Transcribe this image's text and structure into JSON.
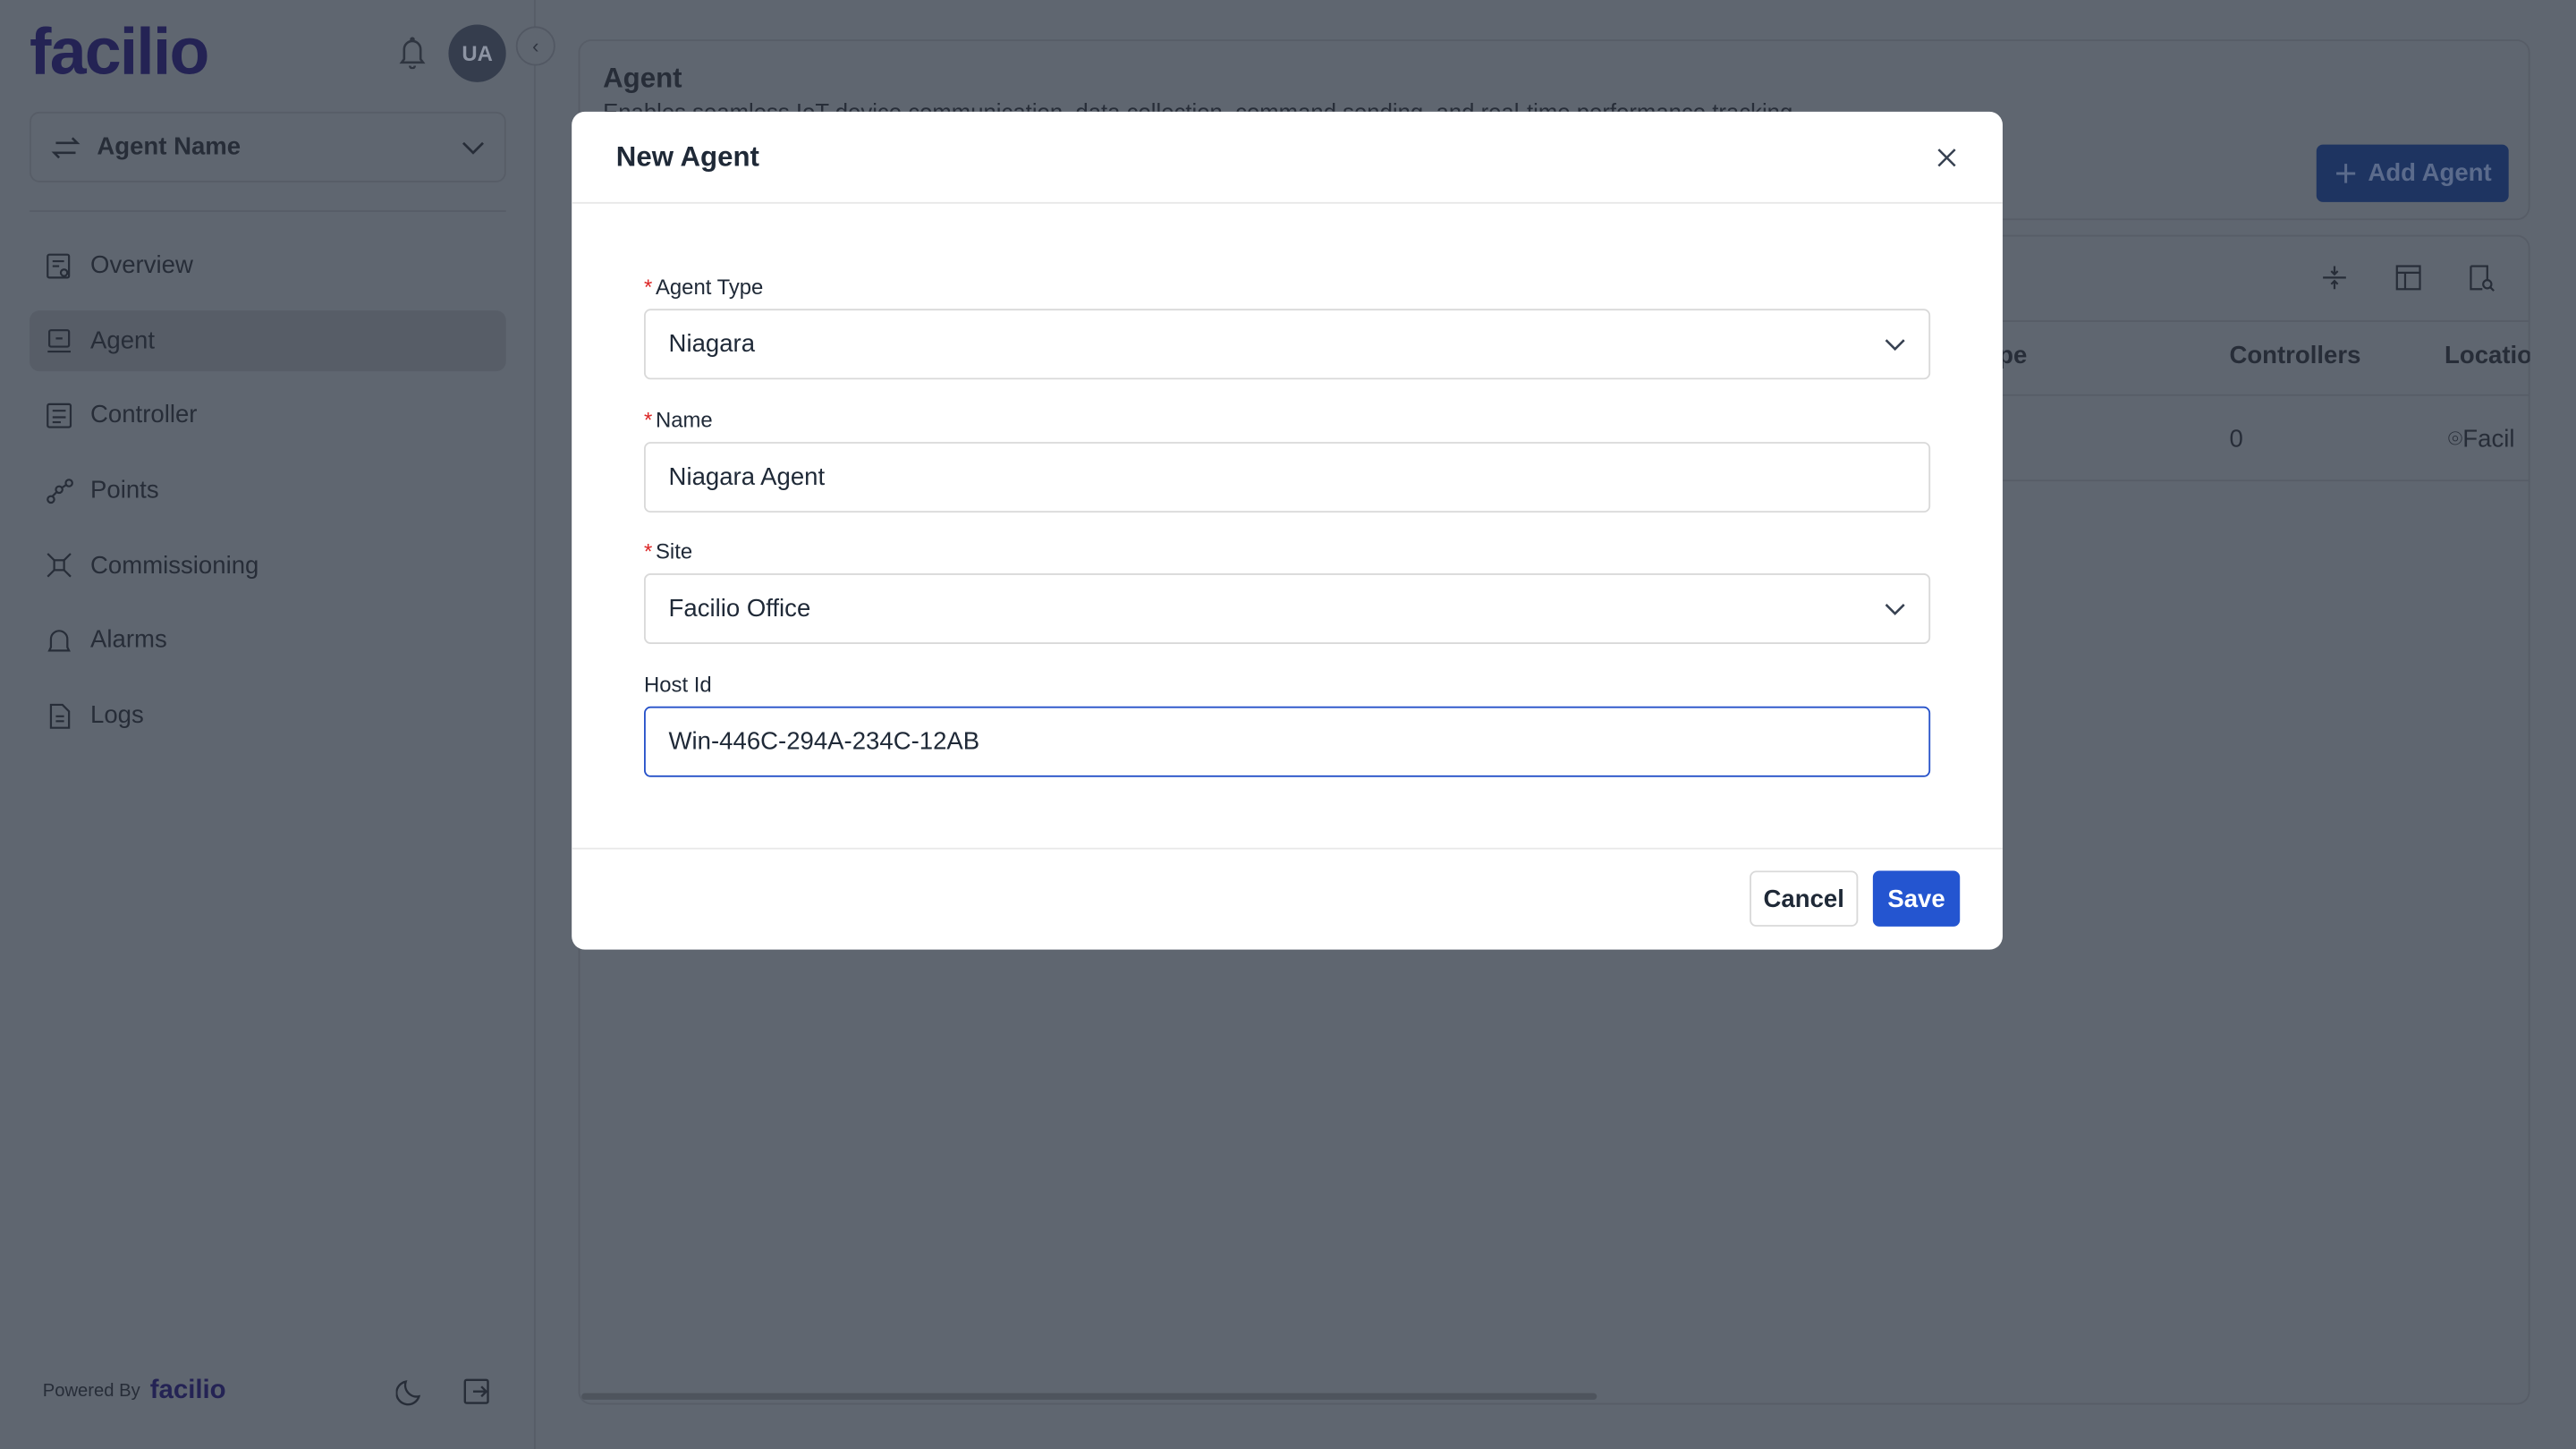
{
  "brand": {
    "logo": "facilio",
    "powered_by": "Powered By",
    "powered_logo": "facilio"
  },
  "header": {
    "avatar_initials": "UA"
  },
  "sidebar": {
    "agent_selector": "Agent Name",
    "items": [
      {
        "label": "Overview",
        "icon": "overview-icon"
      },
      {
        "label": "Agent",
        "icon": "agent-icon",
        "active": true
      },
      {
        "label": "Controller",
        "icon": "controller-icon"
      },
      {
        "label": "Points",
        "icon": "points-icon"
      },
      {
        "label": "Commissioning",
        "icon": "commissioning-icon"
      },
      {
        "label": "Alarms",
        "icon": "bell-icon"
      },
      {
        "label": "Logs",
        "icon": "logs-icon"
      }
    ]
  },
  "main": {
    "title": "Agent",
    "subtitle": "Enables seamless IoT device communication, data collection, command sending, and real-time performance tracking",
    "add_button": "Add Agent",
    "table": {
      "headers": [
        "Type",
        "Controllers",
        "Location"
      ],
      "rows": [
        {
          "type": "",
          "controllers": "0",
          "location": "Facil"
        }
      ]
    },
    "accent": "#1e3461"
  },
  "modal": {
    "title": "New Agent",
    "fields": {
      "agent_type": {
        "label": "Agent Type",
        "required": true,
        "value": "Niagara"
      },
      "name": {
        "label": "Name",
        "required": true,
        "value": "Niagara Agent"
      },
      "site": {
        "label": "Site",
        "required": true,
        "value": "Facilio Office"
      },
      "host_id": {
        "label": "Host Id",
        "required": false,
        "value": "Win-446C-294A-234C-12AB"
      }
    },
    "cancel": "Cancel",
    "save": "Save",
    "save_color": "#2455d0"
  }
}
